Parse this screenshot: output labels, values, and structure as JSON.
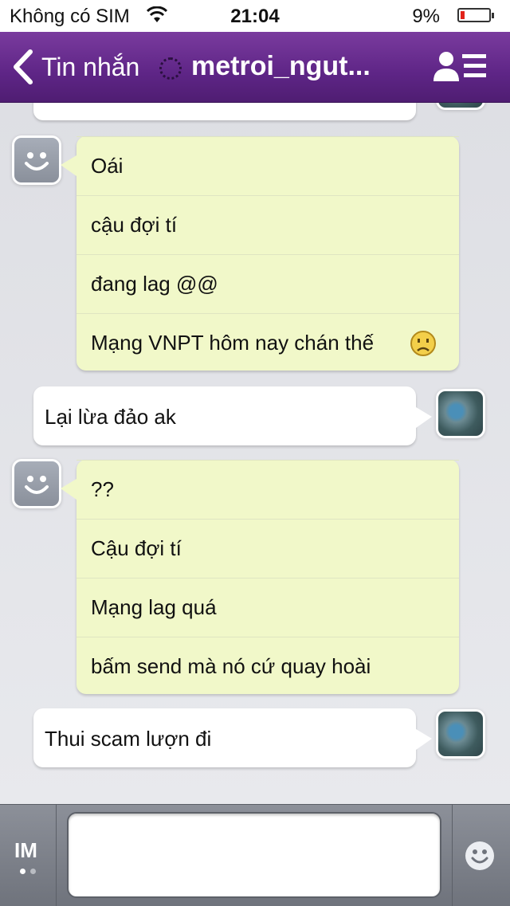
{
  "status_bar": {
    "carrier": "Không có SIM",
    "time": "21:04",
    "battery_pct": "9%",
    "battery_level": 0.09,
    "battery_color": "#e2231a"
  },
  "nav": {
    "back_label": "Tin nhắn",
    "title": "metroi_ngut...",
    "accent": "#5e2586",
    "icons": {
      "back": "chevron-left-icon",
      "loading": "spinner-icon",
      "contact": "contact-list-icon"
    }
  },
  "messages": [
    {
      "from": "contact",
      "lines": [
        "Oái",
        "cậu đợi tí",
        "đang lag @@",
        "Mạng VNPT hôm nay chán thế"
      ],
      "emoji": "sad-face-icon"
    },
    {
      "from": "me",
      "lines": [
        "Lại lừa đảo ak"
      ]
    },
    {
      "from": "contact",
      "lines": [
        "??",
        "Cậu đợi tí",
        "Mạng lag quá",
        "bấm send mà nó cứ quay hoài"
      ]
    },
    {
      "from": "me",
      "lines": [
        "Thui scam lượn đi"
      ]
    }
  ],
  "input_bar": {
    "im_label": "IM",
    "text_value": "",
    "page_dots": 2,
    "active_dot": 1,
    "icons": {
      "emoji": "smiley-icon"
    }
  },
  "colors": {
    "incoming_bubble": "#f1f8c9",
    "outgoing_bubble": "#ffffff",
    "chat_background": "#e4e5e9"
  }
}
